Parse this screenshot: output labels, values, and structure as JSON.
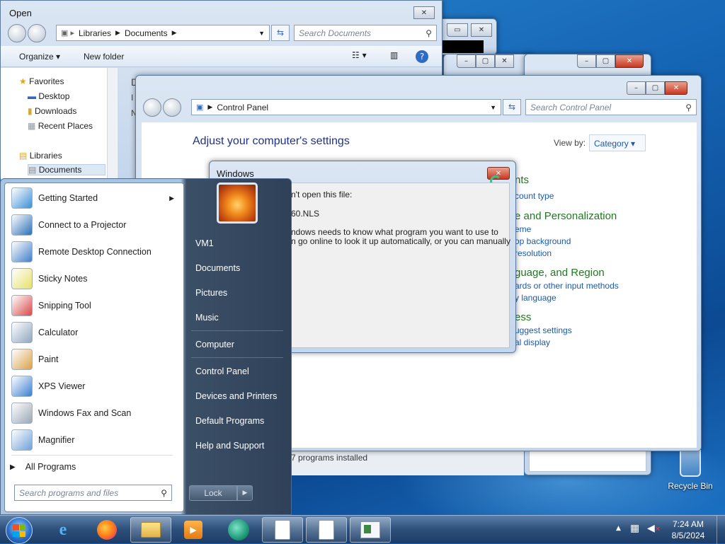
{
  "open_dialog": {
    "title": "Open",
    "address": {
      "crumbs": [
        "Libraries",
        "Documents"
      ]
    },
    "search_placeholder": "Search Documents",
    "toolbar": {
      "organize": "Organize",
      "new_folder": "New folder"
    },
    "nav": {
      "favorites": "Favorites",
      "favorites_items": [
        "Desktop",
        "Downloads",
        "Recent Places"
      ],
      "libraries": "Libraries",
      "libraries_items": [
        "Documents"
      ]
    },
    "content_partial": [
      "D",
      "I",
      "N"
    ]
  },
  "control_panel": {
    "address": "Control Panel",
    "search_placeholder": "Search Control Panel",
    "heading": "Adjust your computer's settings",
    "view_by_label": "View by:",
    "view_by_value": "Category",
    "categories": [
      {
        "title": "nts",
        "links": [
          "count type"
        ]
      },
      {
        "title": "e and Personalization",
        "links": [
          "eme",
          "op background",
          "resolution"
        ]
      },
      {
        "title": "guage, and Region",
        "links": [
          "ards or other input methods",
          "y language"
        ]
      },
      {
        "title": "ess",
        "links": [
          "uggest settings",
          "al display"
        ]
      }
    ]
  },
  "back_window": {
    "status": "7 programs installed"
  },
  "windows_dialog": {
    "title": "Windows",
    "line1": "n't open this file:",
    "file": "60.NLS",
    "msg1": "ndows needs to know what program you want to use to",
    "msg2": "n go online to look it up automatically, or you can manually"
  },
  "start_menu": {
    "programs": [
      {
        "label": "Getting Started",
        "icon": "getting-started-icon",
        "color": "#3a8fd6",
        "arrow": "▶"
      },
      {
        "label": "Connect to a Projector",
        "icon": "projector-icon",
        "color": "#2a6fb8",
        "arrow": ""
      },
      {
        "label": "Remote Desktop Connection",
        "icon": "remote-desktop-icon",
        "color": "#3f7fc8",
        "arrow": ""
      },
      {
        "label": "Sticky Notes",
        "icon": "sticky-notes-icon",
        "color": "#e7e06a",
        "arrow": ""
      },
      {
        "label": "Snipping Tool",
        "icon": "scissors-icon",
        "color": "#d84848",
        "arrow": ""
      },
      {
        "label": "Calculator",
        "icon": "calculator-icon",
        "color": "#8fa6bf",
        "arrow": ""
      },
      {
        "label": "Paint",
        "icon": "paint-palette-icon",
        "color": "#d9a24a",
        "arrow": ""
      },
      {
        "label": "XPS Viewer",
        "icon": "xps-viewer-icon",
        "color": "#3a7fd0",
        "arrow": ""
      },
      {
        "label": "Windows Fax and Scan",
        "icon": "fax-scan-icon",
        "color": "#9aa7b5",
        "arrow": ""
      },
      {
        "label": "Magnifier",
        "icon": "magnifier-icon",
        "color": "#6fa0d8",
        "arrow": ""
      }
    ],
    "all_programs": "All Programs",
    "search_placeholder": "Search programs and files",
    "right_items": [
      "VM1",
      "Documents",
      "Pictures",
      "Music",
      "Computer",
      "Control Panel",
      "Devices and Printers",
      "Default Programs",
      "Help and Support"
    ],
    "lock": "Lock"
  },
  "desktop": {
    "recycle_bin": "Recycle Bin"
  },
  "taskbar": {
    "time": "7:24 AM",
    "date": "8/5/2024"
  }
}
